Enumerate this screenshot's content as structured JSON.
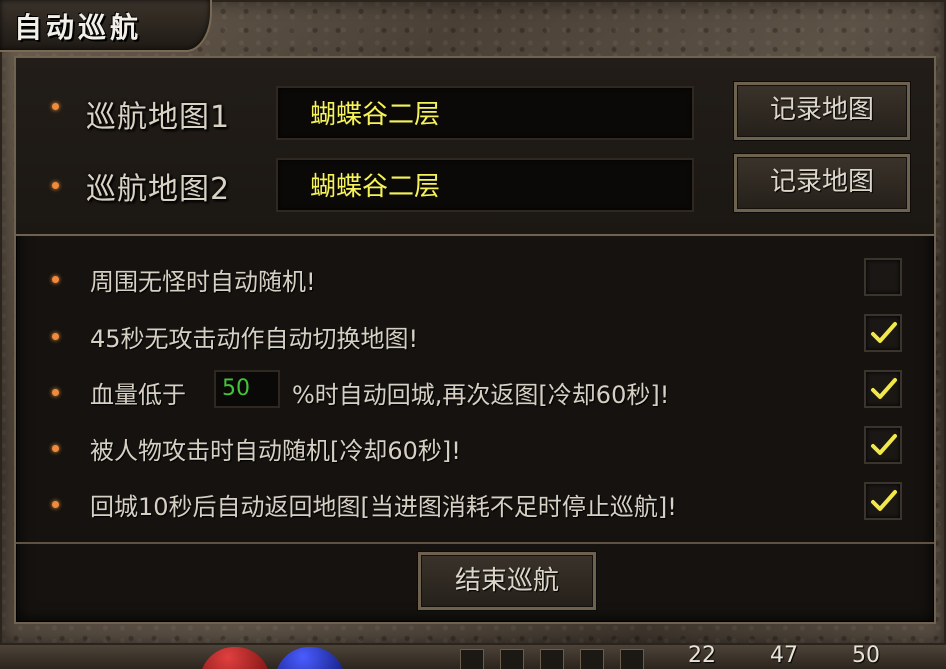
{
  "window": {
    "title": "自动巡航"
  },
  "maps": [
    {
      "label": "巡航地图1",
      "value": "蝴蝶谷二层",
      "button": "记录地图"
    },
    {
      "label": "巡航地图2",
      "value": "蝴蝶谷二层",
      "button": "记录地图"
    }
  ],
  "options": {
    "random_no_monster": {
      "text": "周围无怪时自动随机!",
      "checked": false
    },
    "switch_map_45s": {
      "text": "45秒无攻击动作自动切换地图!",
      "checked": true
    },
    "hp_return": {
      "prefix": "血量低于",
      "value": "50",
      "suffix": "%时自动回城,再次返图[冷却60秒]!",
      "checked": true
    },
    "random_on_attacked": {
      "text": "被人物攻击时自动随机[冷却60秒]!",
      "checked": true
    },
    "return_after_10s": {
      "text": "回城10秒后自动返回地图[当进图消耗不足时停止巡航]!",
      "checked": true
    }
  },
  "end_button": "结束巡航",
  "bottom_bar": {
    "numbers": [
      "22",
      "47",
      "50"
    ]
  },
  "colors": {
    "map_value": "#f5f25a",
    "hp_value": "#44c23c",
    "bullet": "#f08a3c",
    "check": "#f2e84a"
  },
  "icons": {
    "check": "checkmark-icon",
    "bullet": "bullet-dot-icon"
  }
}
